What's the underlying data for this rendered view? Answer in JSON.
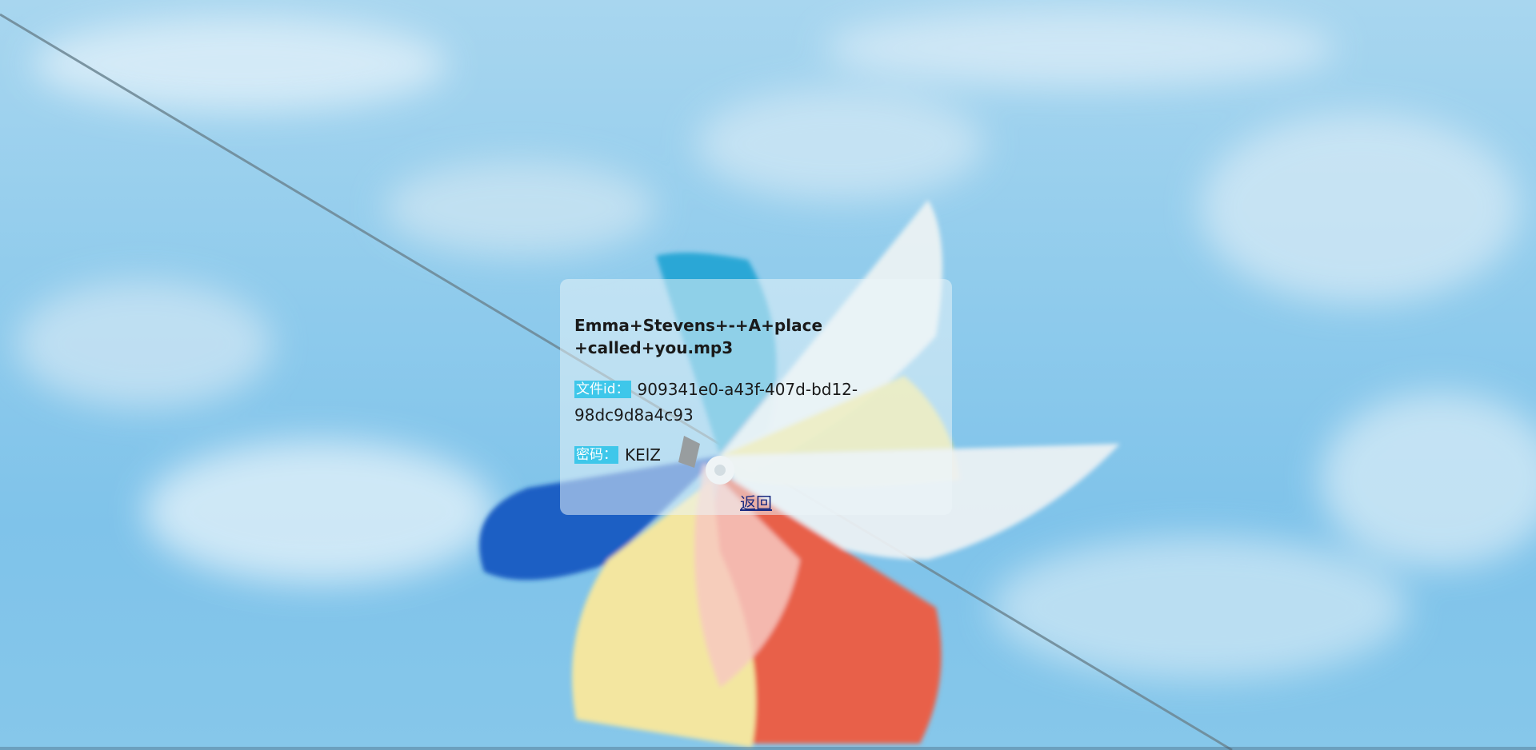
{
  "file": {
    "name": "Emma+Stevens+-+A+place+called+you.mp3",
    "id_label": "文件id：",
    "id_value": "909341e0-a43f-407d-bd12-98dc9d8a4c93",
    "password_label": "密码：",
    "password_value": "KElZ"
  },
  "actions": {
    "back_label": "返回"
  },
  "colors": {
    "label_bg": "#3ec7ea",
    "sky": "#8fcbec",
    "link": "#1a2a80"
  }
}
